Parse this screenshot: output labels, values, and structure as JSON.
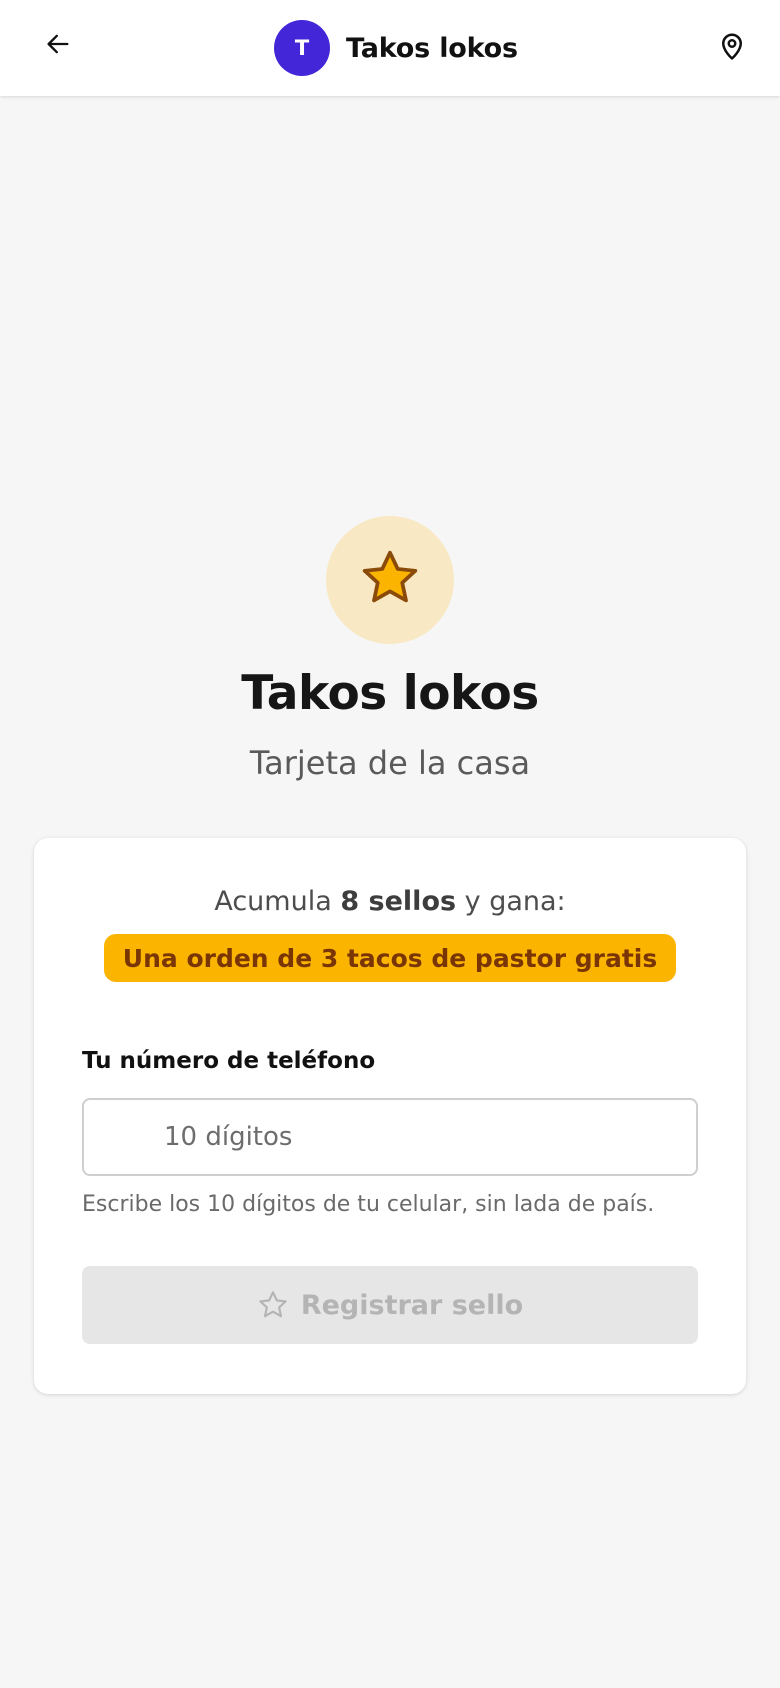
{
  "header": {
    "back_icon": "arrow-left-icon",
    "avatar_initial": "T",
    "avatar_color": "#4426d9",
    "title": "Takos lokos",
    "location_icon": "map-pin-icon"
  },
  "hero": {
    "icon": "star-icon",
    "icon_bg_color": "#f8e8c4",
    "icon_fill_color": "#fbb400",
    "title": "Takos lokos",
    "subtitle": "Tarjeta de la casa"
  },
  "card": {
    "reward_prefix": "Acumula",
    "reward_count": "8 sellos",
    "reward_suffix": "y gana:",
    "reward_text": "Una orden de 3 tacos de pastor gratis",
    "reward_color": "#fbb400",
    "phone_label": "Tu número de teléfono",
    "phone_value": "",
    "phone_placeholder": "10 dígitos",
    "helper_text": "Escribe los 10 dígitos de tu celular, sin lada de país.",
    "button_icon": "star-outline-icon",
    "button_label": "Registrar sello",
    "button_state": "disabled"
  }
}
